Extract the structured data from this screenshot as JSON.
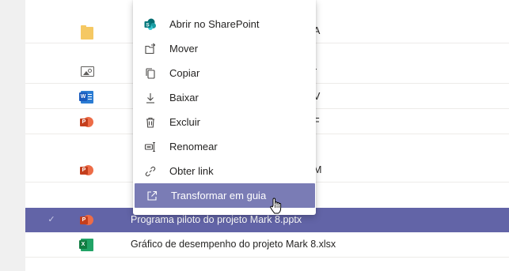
{
  "colors": {
    "accent": "#6264a7",
    "menu_highlight": "#7a7cb5",
    "sharepoint": "#038387",
    "word": "#185abd",
    "powerpoint": "#c43e1c",
    "excel": "#107c41",
    "folder": "#f5c863"
  },
  "files": [
    {
      "type": "folder",
      "icon": "folder-icon",
      "name_visible": "A"
    },
    {
      "type": "image",
      "icon": "image-icon",
      "name_visible": "r"
    },
    {
      "type": "word",
      "icon": "word-icon",
      "badge": "W",
      "name_visible": "V"
    },
    {
      "type": "powerpoint",
      "icon": "powerpoint-icon",
      "badge": "P",
      "name_visible": "F"
    },
    {
      "type": "powerpoint",
      "icon": "powerpoint-icon",
      "badge": "P",
      "name_visible": "M"
    },
    {
      "type": "powerpoint",
      "icon": "powerpoint-icon",
      "badge": "P",
      "selected": true,
      "check": "✓",
      "name": "Programa piloto do projeto Mark 8.pptx"
    },
    {
      "type": "excel",
      "icon": "excel-icon",
      "badge": "X",
      "name": "Gráfico de desempenho do projeto Mark 8.xlsx"
    }
  ],
  "context_menu": {
    "items": [
      {
        "label": "Abrir no SharePoint",
        "icon": "sharepoint-icon"
      },
      {
        "label": "Mover",
        "icon": "move-icon"
      },
      {
        "label": "Copiar",
        "icon": "copy-icon"
      },
      {
        "label": "Baixar",
        "icon": "download-icon"
      },
      {
        "label": "Excluir",
        "icon": "trash-icon"
      },
      {
        "label": "Renomear",
        "icon": "rename-icon"
      },
      {
        "label": "Obter link",
        "icon": "link-icon"
      },
      {
        "label": "Transformar em guia",
        "icon": "open-in-tab-icon",
        "highlighted": true
      }
    ]
  }
}
